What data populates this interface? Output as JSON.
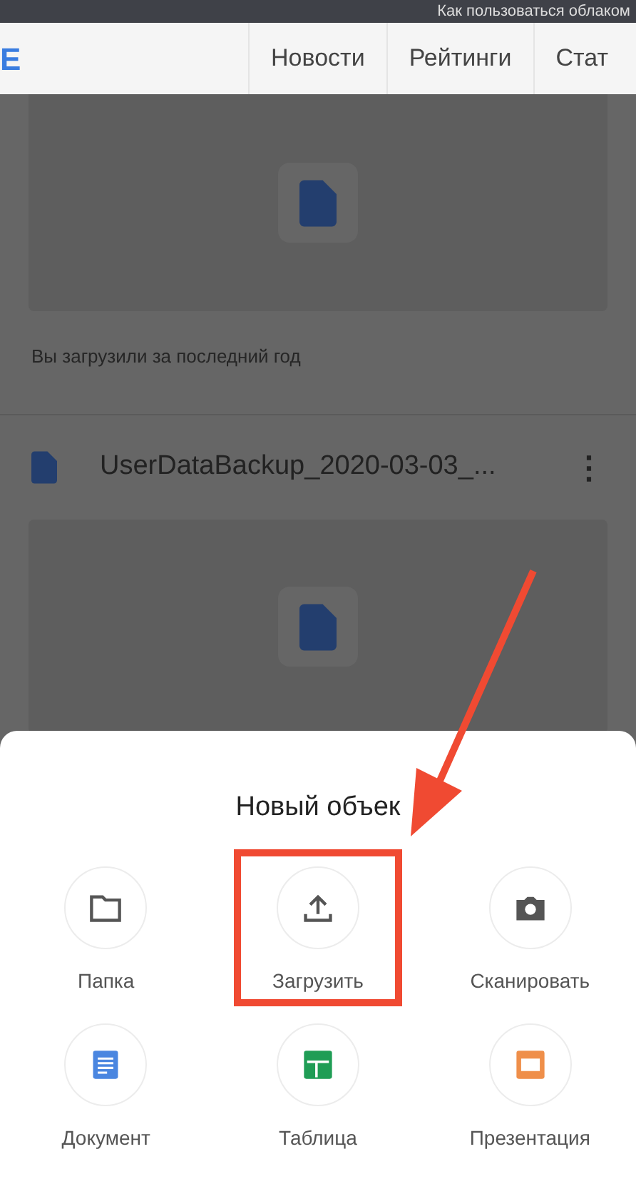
{
  "browser_bar": {
    "title": "Как пользоваться облаком"
  },
  "site_nav": {
    "logo": "E",
    "links": [
      {
        "label": "Новости"
      },
      {
        "label": "Рейтинги"
      },
      {
        "label": "Стат"
      }
    ]
  },
  "files": [
    {
      "caption": "Вы загрузили за последний год"
    },
    {
      "name": "UserDataBackup_2020-03-03_...",
      "menu": "⋮"
    }
  ],
  "sheet": {
    "title": "Новый объек",
    "items": [
      {
        "kind": "folder",
        "label": "Папка",
        "highlighted": false
      },
      {
        "kind": "upload",
        "label": "Загрузить",
        "highlighted": true
      },
      {
        "kind": "scan",
        "label": "Сканировать",
        "highlighted": false
      },
      {
        "kind": "doc",
        "label": "Документ",
        "highlighted": false
      },
      {
        "kind": "sheet",
        "label": "Таблица",
        "highlighted": false
      },
      {
        "kind": "slides",
        "label": "Презентация",
        "highlighted": false
      }
    ]
  }
}
